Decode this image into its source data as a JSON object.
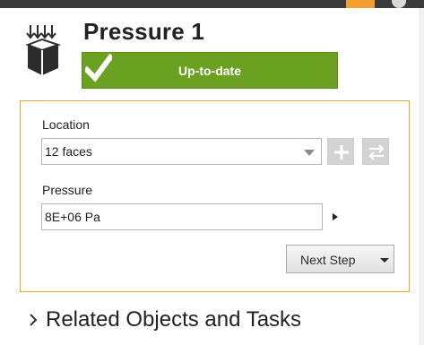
{
  "header": {
    "title": "Pressure 1",
    "status": "Up-to-date",
    "status_color": "#6aa121",
    "icon": "boundary-condition-icon"
  },
  "location": {
    "label": "Location",
    "value": "12 faces",
    "add_icon": "plus-icon",
    "swap_icon": "swap-arrows-icon"
  },
  "pressure": {
    "label": "Pressure",
    "value": "8E+06 Pa"
  },
  "next_step": {
    "label": "Next Step"
  },
  "related": {
    "label": "Related Objects and Tasks"
  },
  "accent_color": "#e8a531"
}
